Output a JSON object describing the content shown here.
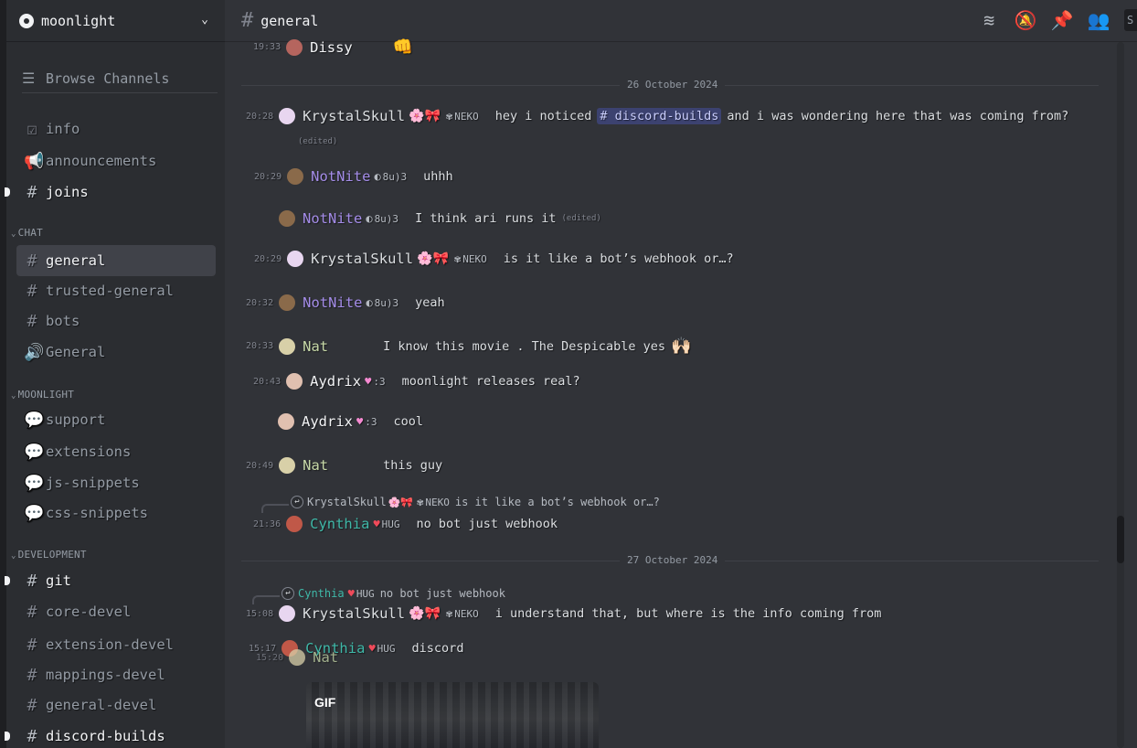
{
  "server": {
    "name": "moonlight",
    "chevron": "⌄"
  },
  "sidebar": {
    "browse_label": "Browse Channels",
    "top_channels": [
      {
        "label": "info",
        "icon": "rules-icon",
        "glyph": "☑"
      },
      {
        "label": "announcements",
        "icon": "megaphone-icon",
        "glyph": "📢"
      },
      {
        "label": "joins",
        "icon": "hash-icon",
        "glyph": "#"
      }
    ],
    "categories": [
      {
        "label": "CHAT",
        "caret": "⌄",
        "channels": [
          {
            "label": "general",
            "glyph": "#"
          },
          {
            "label": "trusted-general",
            "glyph": "#"
          },
          {
            "label": "bots",
            "glyph": "#"
          },
          {
            "label": "General",
            "glyph": "🔊"
          }
        ]
      },
      {
        "label": "MOONLIGHT",
        "caret": "⌄",
        "channels": [
          {
            "label": "support",
            "glyph": "💬"
          },
          {
            "label": "extensions",
            "glyph": "💬"
          },
          {
            "label": "js-snippets",
            "glyph": "💬"
          },
          {
            "label": "css-snippets",
            "glyph": "💬"
          }
        ]
      },
      {
        "label": "DEVELOPMENT",
        "caret": "⌄",
        "channels": [
          {
            "label": "git",
            "glyph": "#"
          },
          {
            "label": "core-devel",
            "glyph": "#"
          },
          {
            "label": "extension-devel",
            "glyph": "#"
          },
          {
            "label": "mappings-devel",
            "glyph": "#"
          },
          {
            "label": "general-devel",
            "glyph": "#"
          },
          {
            "label": "discord-builds",
            "glyph": "#"
          }
        ]
      }
    ]
  },
  "topbar": {
    "hash": "#",
    "channel": "general",
    "icons": [
      "threads-icon",
      "mute-icon",
      "pin-icon",
      "members-icon"
    ],
    "search_hint": "S"
  },
  "messages": {
    "dates": [
      "26 October 2024",
      "27 October 2024"
    ],
    "m0": {
      "time": "19:33",
      "name": "Dissy",
      "text": "👊"
    },
    "m1": {
      "time": "20:28",
      "name": "KrystalSkull",
      "deco": "🌸🎀",
      "tag": "NEKO",
      "text_a": "hey i noticed",
      "mention": "# discord-builds",
      "text_b": "and i was wondering here that was coming from?",
      "edited": "(edited)"
    },
    "m2": {
      "time": "20:29",
      "name": "NotNite",
      "tag": "8u)3",
      "text": "uhhh"
    },
    "m3": {
      "name": "NotNite",
      "tag": "8u)3",
      "text": "I think ari runs it",
      "edited": "(edited)"
    },
    "m4": {
      "time": "20:29",
      "name": "KrystalSkull",
      "deco": "🌸🎀",
      "tag": "NEKO",
      "text": "is it like a bot’s webhook or…?"
    },
    "m5": {
      "time": "20:32",
      "name": "NotNite",
      "tag": "8u)3",
      "text": "yeah"
    },
    "m6": {
      "time": "20:33",
      "name": "Nat",
      "text": "I know this movie . The Despicable yes",
      "emoji": "🙌🏻"
    },
    "m7": {
      "time": "20:43",
      "name": "Aydrix",
      "tag": ":3",
      "text": "moonlight releases real?"
    },
    "m8": {
      "name": "Aydrix",
      "tag": ":3",
      "text": "cool"
    },
    "m9": {
      "time": "20:49",
      "name": "Nat",
      "text": "this guy"
    },
    "r10": {
      "name": "KrystalSkull",
      "deco": "🌸🎀",
      "tag": "NEKO",
      "text": "is it like a bot’s webhook or…?"
    },
    "m10": {
      "time": "21:36",
      "name": "Cynthia",
      "tag": "HUG",
      "text": "no bot just webhook"
    },
    "r11": {
      "name": "Cynthia",
      "tag": "HUG",
      "text": "no bot just webhook"
    },
    "m11": {
      "time": "15:08",
      "name": "KrystalSkull",
      "deco": "🌸🎀",
      "tag": "NEKO",
      "text": "i understand that, but where is the info coming from"
    },
    "m12": {
      "time": "15:17",
      "name": "Cynthia",
      "tag": "HUG",
      "text": "discord"
    },
    "m13": {
      "time": "15:20",
      "name": "Nat"
    },
    "gif_label": "GIF"
  },
  "colors": {
    "krystal": "#dbdee1",
    "notnite": "#a48ce8",
    "aydrix": "#f2f3f5",
    "nat": "#c7d9a8",
    "cynthia": "#3fb8a8",
    "mention_bg": "#3c4270"
  }
}
